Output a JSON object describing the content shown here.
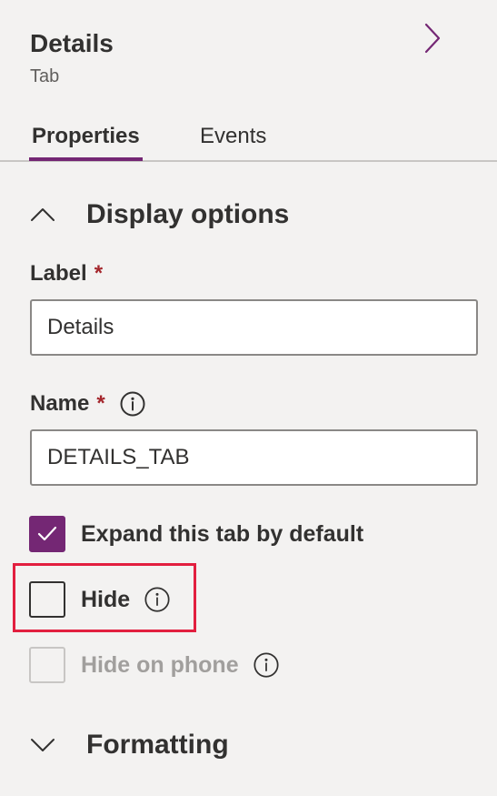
{
  "header": {
    "title": "Details",
    "subtitle": "Tab"
  },
  "tabs": [
    {
      "label": "Properties",
      "active": true
    },
    {
      "label": "Events",
      "active": false
    }
  ],
  "sections": {
    "display_options": {
      "title": "Display options",
      "expanded": true
    },
    "formatting": {
      "title": "Formatting",
      "expanded": false
    }
  },
  "fields": {
    "label": {
      "label": "Label",
      "required_marker": "*",
      "value": "Details"
    },
    "name": {
      "label": "Name",
      "required_marker": "*",
      "value": "DETAILS_TAB"
    }
  },
  "checkboxes": {
    "expand_by_default": {
      "label": "Expand this tab by default",
      "checked": true
    },
    "hide": {
      "label": "Hide",
      "checked": false
    },
    "hide_on_phone": {
      "label": "Hide on phone",
      "checked": false,
      "disabled": true
    }
  },
  "colors": {
    "accent": "#742774",
    "required": "#a4262c",
    "highlight": "#e21f3f",
    "background": "#f3f2f1"
  }
}
